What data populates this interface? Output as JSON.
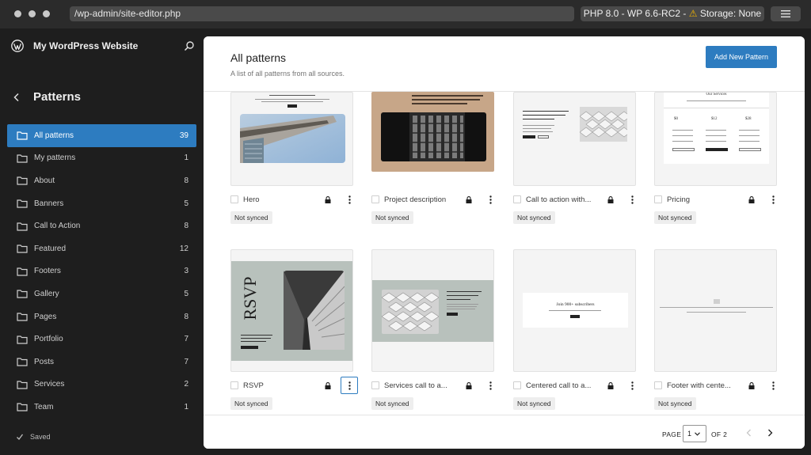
{
  "browser": {
    "url": "/wp-admin/site-editor.php",
    "env_prefix": "PHP 8.0 - WP 6.6-RC2 - ",
    "env_warning": "⚠",
    "env_suffix": " Storage: None"
  },
  "sidebar": {
    "site_title": "My WordPress Website",
    "section_title": "Patterns",
    "items": [
      {
        "label": "All patterns",
        "count": "39"
      },
      {
        "label": "My patterns",
        "count": "1"
      },
      {
        "label": "About",
        "count": "8"
      },
      {
        "label": "Banners",
        "count": "5"
      },
      {
        "label": "Call to Action",
        "count": "8"
      },
      {
        "label": "Featured",
        "count": "12"
      },
      {
        "label": "Footers",
        "count": "3"
      },
      {
        "label": "Gallery",
        "count": "5"
      },
      {
        "label": "Pages",
        "count": "8"
      },
      {
        "label": "Portfolio",
        "count": "7"
      },
      {
        "label": "Posts",
        "count": "7"
      },
      {
        "label": "Services",
        "count": "2"
      },
      {
        "label": "Team",
        "count": "1"
      }
    ],
    "status": "Saved"
  },
  "main": {
    "title": "All patterns",
    "subtitle": "A list of all patterns from all sources.",
    "add_button": "Add New Pattern",
    "patterns": [
      {
        "title": "Hero",
        "badge": "Not synced"
      },
      {
        "title": "Project description",
        "badge": "Not synced"
      },
      {
        "title": "Call to action with...",
        "badge": "Not synced"
      },
      {
        "title": "Pricing",
        "badge": "Not synced"
      },
      {
        "title": "RSVP",
        "badge": "Not synced"
      },
      {
        "title": "Services call to a...",
        "badge": "Not synced"
      },
      {
        "title": "Centered call to a...",
        "badge": "Not synced"
      },
      {
        "title": "Footer with cente...",
        "badge": "Not synced"
      }
    ],
    "thumb_text": {
      "rsvp": "RSVP",
      "pricing_heading": "Our Services",
      "pricing_prices": [
        "$0",
        "$12",
        "$28"
      ],
      "subscribers": "Join 900+ subscribers",
      "services_heading": "Guiding your business through the project",
      "cta_heading": "Enhance your architectural journey with the Études Architect app.",
      "project_heading": "Ancient cultural heritage, accessibility, and rehabilitate spaces while preserving its rich cultural heritage."
    }
  },
  "pagination": {
    "page_label": "PAGE",
    "current": "1",
    "of_label": "OF 2"
  },
  "colors": {
    "accent": "#2d7cc0",
    "sidebar_bg": "#1e1e1e",
    "warning": "#f0b400"
  }
}
